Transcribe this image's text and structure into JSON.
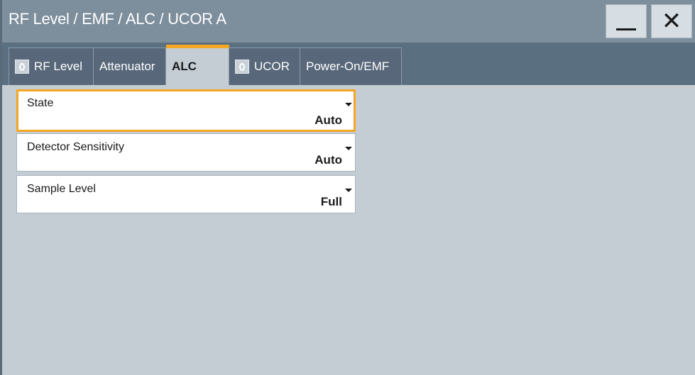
{
  "window": {
    "title": "RF Level / EMF / ALC / UCOR A",
    "minimize_icon": "minimize-icon",
    "close_icon": "close-icon",
    "close_glyph": "✕"
  },
  "tabs": [
    {
      "label": "RF Level",
      "has_led": true,
      "active": false
    },
    {
      "label": "Attenuator",
      "has_led": false,
      "active": false
    },
    {
      "label": "ALC",
      "has_led": false,
      "active": true
    },
    {
      "label": "UCOR",
      "has_led": true,
      "active": false
    },
    {
      "label": "Power-On/EMF",
      "has_led": false,
      "active": false
    }
  ],
  "fields": {
    "state": {
      "label": "State",
      "value": "Auto"
    },
    "detector_sensitivity": {
      "label": "Detector Sensitivity",
      "value": "Auto"
    },
    "sample_level": {
      "label": "Sample Level",
      "value": "Full"
    }
  },
  "colors": {
    "accent": "#f5a623",
    "titlebar": "#7d8e9c",
    "tabbar": "#5a6f80",
    "content_bg": "#c4cdd3"
  }
}
